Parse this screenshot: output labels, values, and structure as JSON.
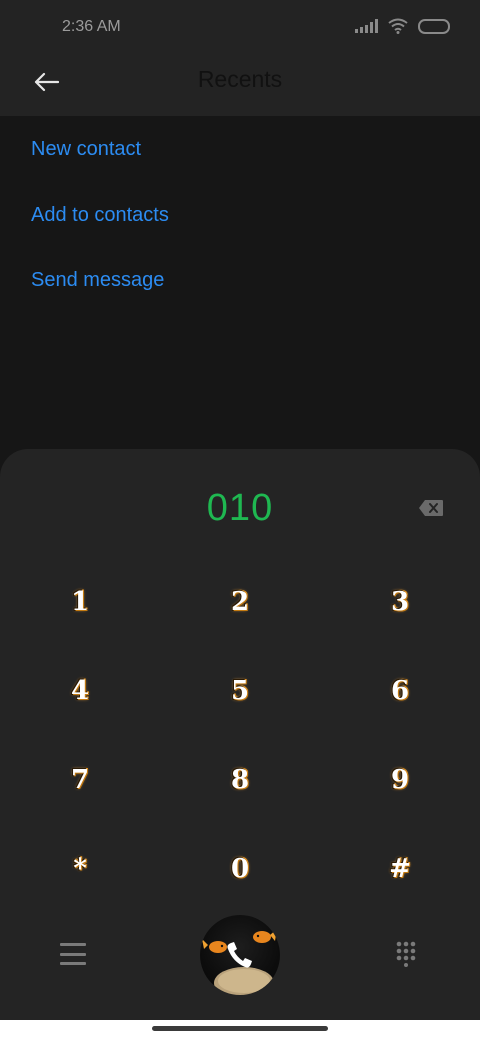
{
  "status_bar": {
    "time": "2:36 AM",
    "icons": [
      "signal-icon",
      "wifi-icon",
      "battery-icon"
    ]
  },
  "header": {
    "title": "Recents",
    "back_icon": "back-arrow-icon"
  },
  "options": [
    {
      "label": "New contact"
    },
    {
      "label": "Add to contacts"
    },
    {
      "label": "Send message"
    }
  ],
  "dialer": {
    "number": "010",
    "backspace_icon": "backspace-icon",
    "keys": [
      "1",
      "2",
      "3",
      "4",
      "5",
      "6",
      "7",
      "8",
      "9",
      "*",
      "0",
      "#"
    ],
    "menu_icon": "menu-icon",
    "call_icon": "phone-call-icon",
    "keypad_icon": "dialpad-icon"
  },
  "colors": {
    "accent_blue": "#2c8cf2",
    "number_green": "#1fb851",
    "background": "#161616",
    "panel": "#242424"
  }
}
